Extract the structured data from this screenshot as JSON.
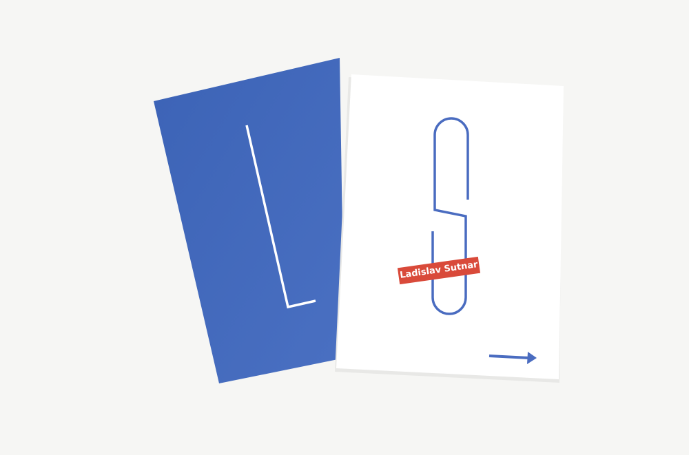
{
  "photo": {
    "cover_label": "Ladislav Sutnar",
    "colors": {
      "background": "#f6f6f4",
      "blue_cover": "#4268b8",
      "red_label": "#d94a3a",
      "line_blue": "#4a6cc0"
    }
  }
}
